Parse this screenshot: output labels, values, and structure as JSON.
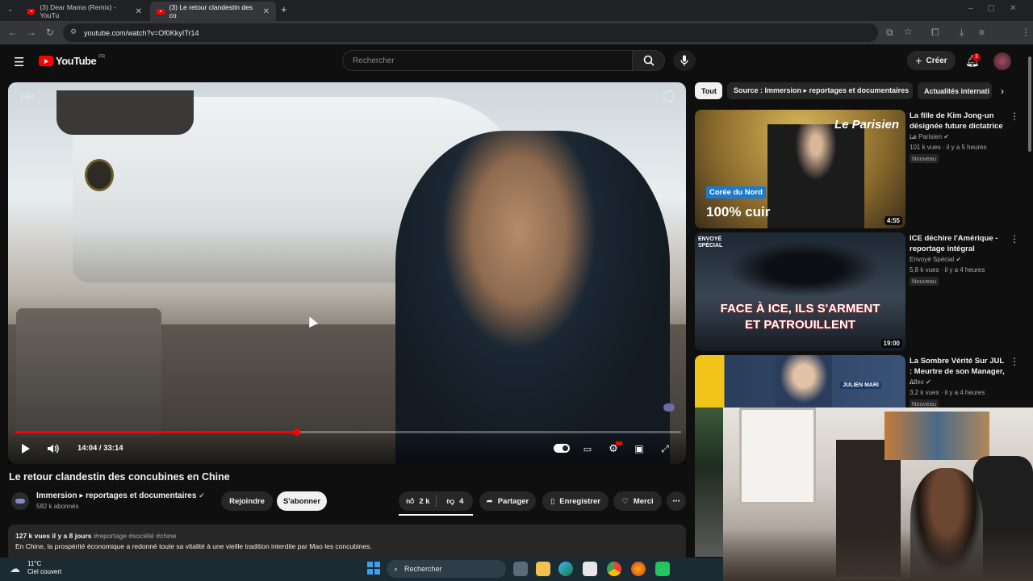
{
  "browser": {
    "tabs": [
      {
        "label": "(3) Dear Mama (Remix) - YouTu"
      },
      {
        "label": "(3) Le retour clandestin des co"
      }
    ],
    "url": "youtube.com/watch?v=Of0KkyITr14"
  },
  "youtube": {
    "logo": "YouTube",
    "region": "FR",
    "search_placeholder": "Rechercher",
    "create_label": "Créer",
    "notif_count": "3"
  },
  "video": {
    "speed_overlay": "1.50",
    "time": "14:04 / 33:14",
    "progress": 0.423,
    "title": "Le retour clandestin des concubines en Chine"
  },
  "channel": {
    "name": "Immersion ▸ reportages et documentaires",
    "subs": "582 k abonnés",
    "join": "Rejoindre",
    "subscribe": "S'abonner"
  },
  "actions": {
    "likes": "2 k",
    "dislikes": "4",
    "share": "Partager",
    "save": "Enregistrer",
    "thanks": "Merci"
  },
  "description": {
    "meta": "127 k vues  il y a 8 jours",
    "tags": "#reportage #société #chine",
    "line1": "En Chine, la prospérité économique a redonné toute sa vitalité à une vieille tradition interdite par Mao  les concubines."
  },
  "chips": [
    "Tout",
    "Source : Immersion ▸ reportages et documentaires",
    "Actualités internati"
  ],
  "recommendations": [
    {
      "title": "La fille de Kim Jong-un désignée future dictatrice ...",
      "channel": "Le Parisien",
      "meta": "101 k vues · il y a 5 heures",
      "badge": "Nouveau",
      "duration": "4:55",
      "thumb_text": [
        "Corée du Nord",
        "100% cuir",
        "Le Parisien"
      ]
    },
    {
      "title": "ICE déchire l'Amérique - reportage intégral",
      "channel": "Envoyé Spécial",
      "meta": "5,8 k vues · il y a 4 heures",
      "badge": "Nouveau",
      "duration": "19:00",
      "thumb_text": [
        "FACE À ICE, ILS S'ARMENT",
        "ET PATROUILLENT",
        "ENVOYÉ SPÉCIAL"
      ]
    },
    {
      "title": "La Sombre Vérité Sur JUL : Meurtre de son Manager, ...",
      "channel": "Aflex",
      "meta": "3,2 k vues · il y a 4 heures",
      "badge": "Nouveau",
      "duration": "",
      "thumb_text": [
        "JULIEN MARI"
      ]
    }
  ],
  "taskbar": {
    "temp": "11°C",
    "weather": "Ciel couvert",
    "search": "Rechercher"
  },
  "colors": {
    "accent": "#ff0000",
    "bg": "#0f0f0f"
  }
}
